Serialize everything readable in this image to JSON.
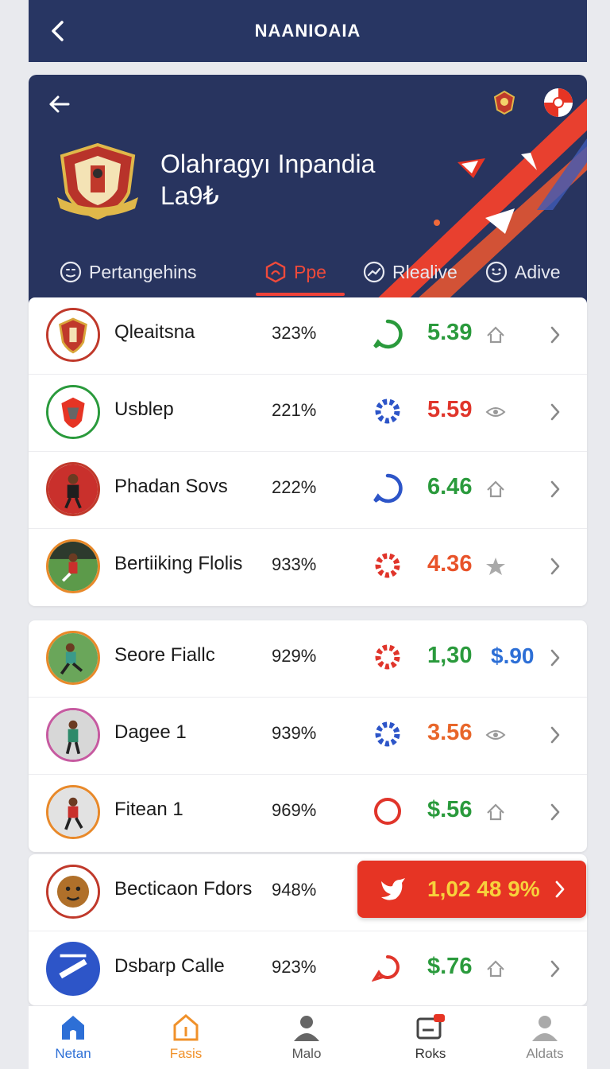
{
  "topbar": {
    "title": "NAANIOAIA"
  },
  "hero": {
    "title_line1": "Olahragyı Inpandia",
    "title_line2": "La9₺",
    "tabs": [
      {
        "label": "Pertangehins",
        "icon": "trophy-face-icon",
        "active": false
      },
      {
        "label": "Ppe",
        "icon": "hexagon-icon",
        "active": true
      },
      {
        "label": "Rlealive",
        "icon": "trend-line-icon",
        "active": false
      },
      {
        "label": "Adive",
        "icon": "refresh-face-icon",
        "active": false
      }
    ]
  },
  "list_groups": [
    [
      {
        "name": "Qleaitsna",
        "pct": "323%",
        "status_icon": "green-circle-icon",
        "value": "5.39",
        "value_color": "#2a9a3c",
        "trend_icon": "home-arrow-icon"
      },
      {
        "name": "Usblep",
        "pct": "221%",
        "status_icon": "blue-gear-icon",
        "value": "5.59",
        "value_color": "#e0352b",
        "trend_icon": "eye-arrow-icon"
      },
      {
        "name": "Phadan Sovs",
        "pct": "222%",
        "status_icon": "blue-circle-icon",
        "value": "6.46",
        "value_color": "#2a9a3c",
        "trend_icon": "home-arrow-icon"
      },
      {
        "name": "Bertiiking Flolis",
        "pct": "933%",
        "status_icon": "red-gear-icon",
        "value": "4.36",
        "value_color": "#e8532a",
        "trend_icon": "star-icon"
      }
    ],
    [
      {
        "name": "Seore Fiallc",
        "pct": "929%",
        "status_icon": "red-gear-icon",
        "value": "1,30",
        "value_color": "#2a9a3c",
        "extra": "$.90",
        "trend_icon": ""
      },
      {
        "name": "Dagee 1",
        "pct": "939%",
        "status_icon": "blue-gear-icon",
        "value": "3.56",
        "value_color": "#e8662a",
        "trend_icon": "eye-arrow-icon"
      },
      {
        "name": "Fitean 1",
        "pct": "969%",
        "status_icon": "red-circle-icon",
        "value": "$.56",
        "value_color": "#2a9a3c",
        "trend_icon": "home-arrow-icon"
      }
    ],
    [
      {
        "name": "Becticaon Fdors",
        "pct": "948%",
        "highlight": true,
        "highlight_value": "1,02  48 9%"
      },
      {
        "name": "Dsbarp Calle",
        "pct": "923%",
        "status_icon": "red-chat-icon",
        "value": "$.76",
        "value_color": "#2a9a3c",
        "trend_icon": "home-arrow-icon"
      }
    ]
  ],
  "bottom_nav": [
    {
      "label": "Netan",
      "icon": "home-icon",
      "color": "#2d6fd6"
    },
    {
      "label": "Fasis",
      "icon": "house-outline-icon",
      "color": "#f0912a"
    },
    {
      "label": "Malo",
      "icon": "person-icon",
      "color": "#555555"
    },
    {
      "label": "Roks",
      "icon": "card-icon",
      "color": "#333333"
    },
    {
      "label": "Aldats",
      "icon": "person-icon",
      "color": "#888888"
    }
  ]
}
